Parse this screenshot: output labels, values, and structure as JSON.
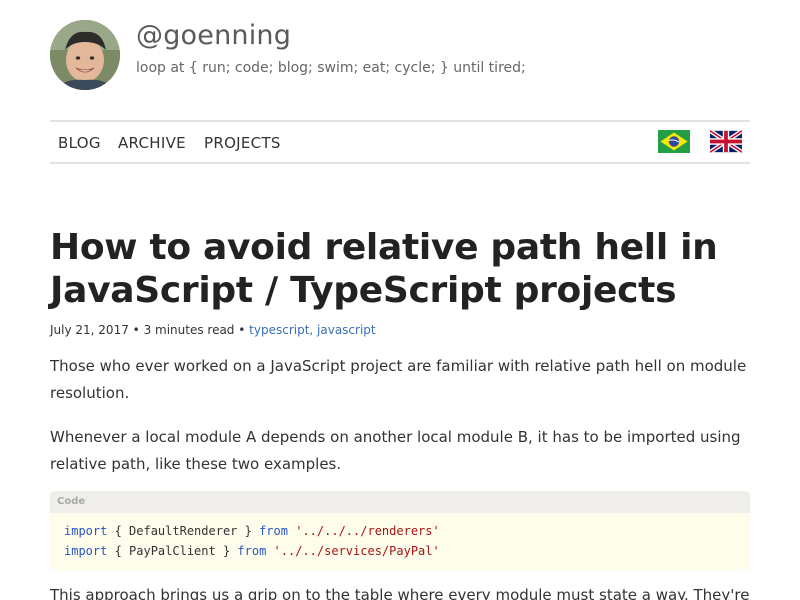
{
  "header": {
    "site_title": "@goenning",
    "tagline": "loop at { run; code; blog; swim; eat; cycle; } until tired;"
  },
  "nav": {
    "items": [
      {
        "label": "BLOG"
      },
      {
        "label": "ARCHIVE"
      },
      {
        "label": "PROJECTS"
      }
    ],
    "languages": [
      "brazil-flag-icon",
      "uk-flag-icon"
    ]
  },
  "post": {
    "title": "How to avoid relative path hell in JavaScript / TypeScript projects",
    "date": "July 21, 2017",
    "separator": " • ",
    "read_time": "3 minutes read",
    "tags": "typescript, javascript",
    "paragraphs": [
      "Those who ever worked on a JavaScript project are familiar with relative path hell on module resolution.",
      "Whenever a local module A depends on another local module B, it has to be imported using relative path, like these two examples.",
      "This approach brings us a grip on to the table where every module must state a way. They're"
    ],
    "code": {
      "header": "Code",
      "lines": [
        {
          "kw1": "import",
          "mid": " { DefaultRenderer } ",
          "kw2": "from",
          "str": "'../../../renderers'"
        },
        {
          "kw1": "import",
          "mid": " { PayPalClient } ",
          "kw2": "from",
          "str": "'../../services/PayPal'"
        }
      ]
    }
  },
  "colors": {
    "link": "#3b6fb6",
    "keyword": "#2a55c6",
    "string": "#a31515",
    "code_bg": "#fefdeb",
    "code_header_bg": "#efeeea"
  }
}
